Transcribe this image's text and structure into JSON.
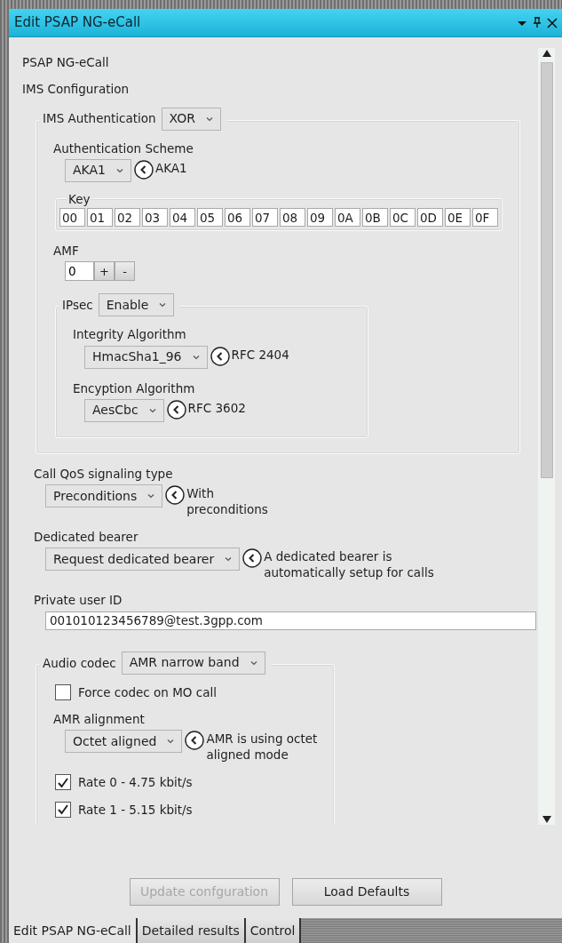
{
  "window": {
    "title": "Edit PSAP NG-eCall"
  },
  "form": [
    {
      "kind": "text",
      "text": "PSAP NG-eCall"
    },
    {
      "kind": "text",
      "text": "IMS Configuration"
    },
    {
      "kind": "group",
      "label": "IMS Authentication",
      "value": "XOR",
      "children": [
        {
          "kind": "dropdown",
          "label": "Authentication Scheme",
          "value": "AKA1",
          "hint": "AKA1"
        },
        {
          "kind": "bytes",
          "label": "Key",
          "values": [
            "00",
            "01",
            "02",
            "03",
            "04",
            "05",
            "06",
            "07",
            "08",
            "09",
            "0A",
            "0B",
            "0C",
            "0D",
            "0E",
            "0F"
          ]
        },
        {
          "kind": "spinner",
          "label": "AMF",
          "value": "0",
          "buttons": [
            "+",
            "-"
          ]
        },
        {
          "kind": "group",
          "label": "IPsec",
          "value": "Enable",
          "children": [
            {
              "kind": "dropdown",
              "label": "Integrity Algorithm",
              "value": "HmacSha1_96",
              "hint": "RFC 2404"
            },
            {
              "kind": "dropdown",
              "label": "Encyption Algorithm",
              "value": "AesCbc",
              "hint": "RFC 3602"
            }
          ]
        }
      ]
    },
    {
      "kind": "dropdown",
      "label": "Call QoS signaling type",
      "value": "Preconditions",
      "hint": "With\npreconditions"
    },
    {
      "kind": "dropdown",
      "label": "Dedicated bearer",
      "value": "Request dedicated bearer",
      "hint": "A dedicated bearer is\nautomatically setup for calls"
    },
    {
      "kind": "input",
      "label": "Private user ID",
      "value": "001010123456789@test.3gpp.com"
    },
    {
      "kind": "group",
      "label": "Audio codec",
      "value": "AMR narrow band",
      "children": [
        {
          "kind": "checkbox",
          "label": "Force codec on MO call",
          "checked": false
        },
        {
          "kind": "dropdown",
          "label": "AMR alignment",
          "value": "Octet aligned",
          "hint": "AMR is using octet\naligned mode"
        },
        {
          "kind": "checkbox",
          "label": "Rate 0 - 4.75 kbit/s",
          "checked": true
        },
        {
          "kind": "checkbox",
          "label": "Rate 1 - 5.15 kbit/s",
          "checked": true
        }
      ]
    }
  ],
  "buttons": [
    {
      "label": "Update confguration",
      "disabled": true
    },
    {
      "label": "Load Defaults",
      "disabled": false
    }
  ],
  "tabs": [
    {
      "label": "Edit PSAP NG-eCall",
      "selected": true
    },
    {
      "label": "Detailed results",
      "selected": false
    },
    {
      "label": "Control",
      "selected": false
    }
  ]
}
